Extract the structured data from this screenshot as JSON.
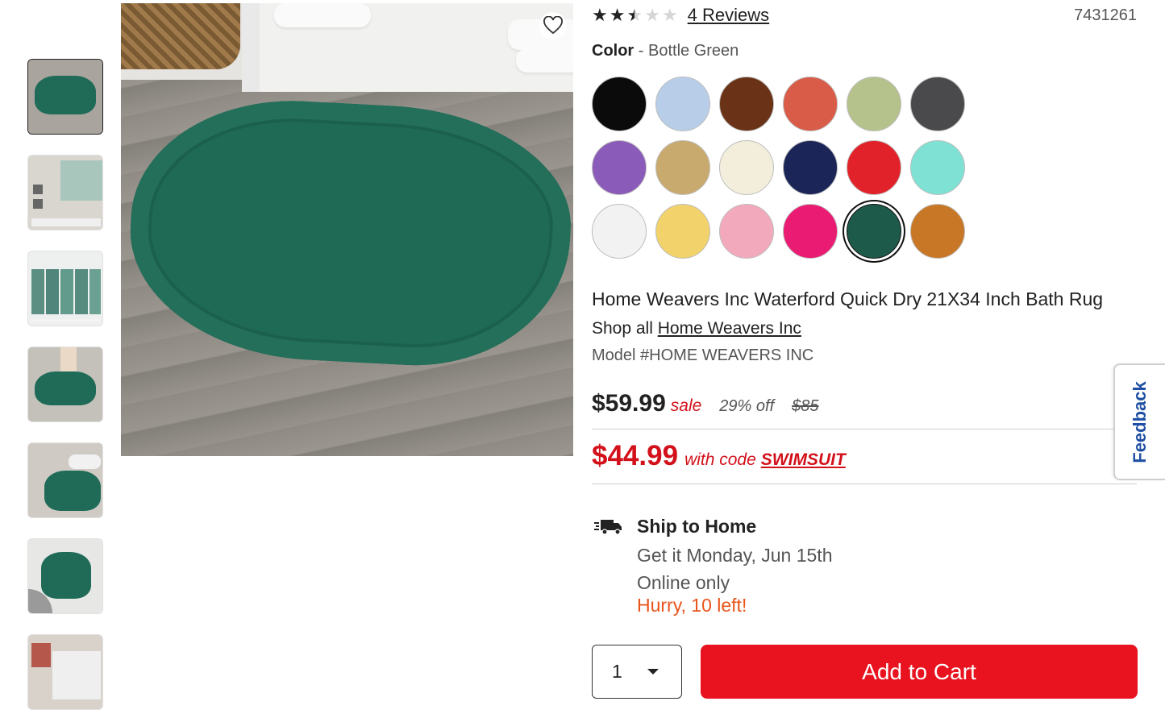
{
  "product": {
    "rating_value": 2.5,
    "rating_max": 5,
    "reviews_label": "4 Reviews",
    "sku": "7431261",
    "title": "Home Weavers Inc Waterford Quick Dry 21X34 Inch Bath Rug",
    "shop_all_prefix": "Shop all",
    "brand": "Home Weavers Inc",
    "model": "Model #HOME WEAVERS INC"
  },
  "color": {
    "label": "Color",
    "separator": "-",
    "selected_name": "Bottle Green",
    "swatches": [
      {
        "color": "#0b0b0b"
      },
      {
        "color": "#b7cde8"
      },
      {
        "color": "#6a3216"
      },
      {
        "color": "#d85c47"
      },
      {
        "color": "#b5c28b"
      },
      {
        "color": "#4a4a4c"
      },
      {
        "color": "#8a5bb8"
      },
      {
        "color": "#c9aa6e"
      },
      {
        "color": "#f3eedc"
      },
      {
        "color": "#1c2557"
      },
      {
        "color": "#e2222a"
      },
      {
        "color": "#7fe1d3"
      },
      {
        "color": "#f2f2f2"
      },
      {
        "color": "#f2d26a"
      },
      {
        "color": "#f2a9bb"
      },
      {
        "color": "#ea1b72"
      },
      {
        "color": "#1d5a4a",
        "selected": true
      },
      {
        "color": "#c77726"
      }
    ]
  },
  "pricing": {
    "price": "$59.99",
    "sale_label": "sale",
    "discount": "29% off",
    "original": "$85",
    "promo_price": "$44.99",
    "promo_with": "with code",
    "promo_code": "SWIMSUIT"
  },
  "shipping": {
    "title": "Ship to Home",
    "date": "Get it Monday, Jun 15th",
    "availability": "Online only",
    "stock_alert": "Hurry, 10 left!"
  },
  "cart": {
    "quantity": "1",
    "add_label": "Add to Cart"
  },
  "feedback_label": "Feedback",
  "colors": {
    "accent_red": "#e8131f",
    "stock_orange": "#e8541a",
    "feedback_blue": "#1f4fa3"
  }
}
